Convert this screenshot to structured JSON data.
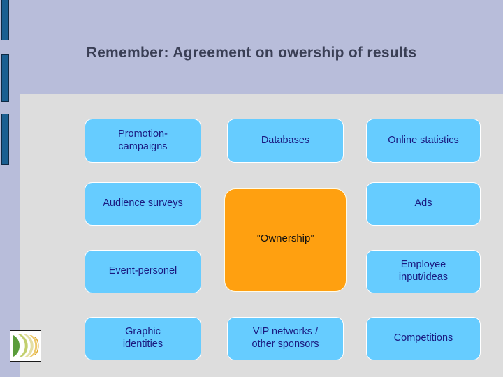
{
  "slide": {
    "title": "Remember: Agreement on owership of results",
    "background_color": "#b8bdda",
    "panel_color": "#dddddd",
    "accent_bar_color": "#1a5f91",
    "node_blue_color": "#66ccff",
    "node_blue_text_color": "#1a1a80",
    "node_orange_color": "#ffa010",
    "node_orange_text_color": "#101010"
  },
  "nodes": {
    "promotion_campaigns": "Promotion-\ncampaigns",
    "promotion_campaigns_line1": "Promotion-",
    "promotion_campaigns_line2": "campaigns",
    "databases": "Databases",
    "online_statistics": "Online statistics",
    "audience_surveys": "Audience surveys",
    "ownership": "”Ownership”",
    "ads": "Ads",
    "event_personel": "Event-personel",
    "employee_input_line1": "Employee",
    "employee_input_line2": "input/ideas",
    "graphic_identities_line1": "Graphic",
    "graphic_identities_line2": "identities",
    "vip_networks_line1": "VIP networks /",
    "vip_networks_line2": "other sponsors",
    "competitions": "Competitions"
  },
  "logo": {
    "name": "arc-wave-logo",
    "colors": [
      "#5a9c3a",
      "#a8c45a",
      "#d8d58a",
      "#efe6b8",
      "#e8b73a"
    ]
  }
}
